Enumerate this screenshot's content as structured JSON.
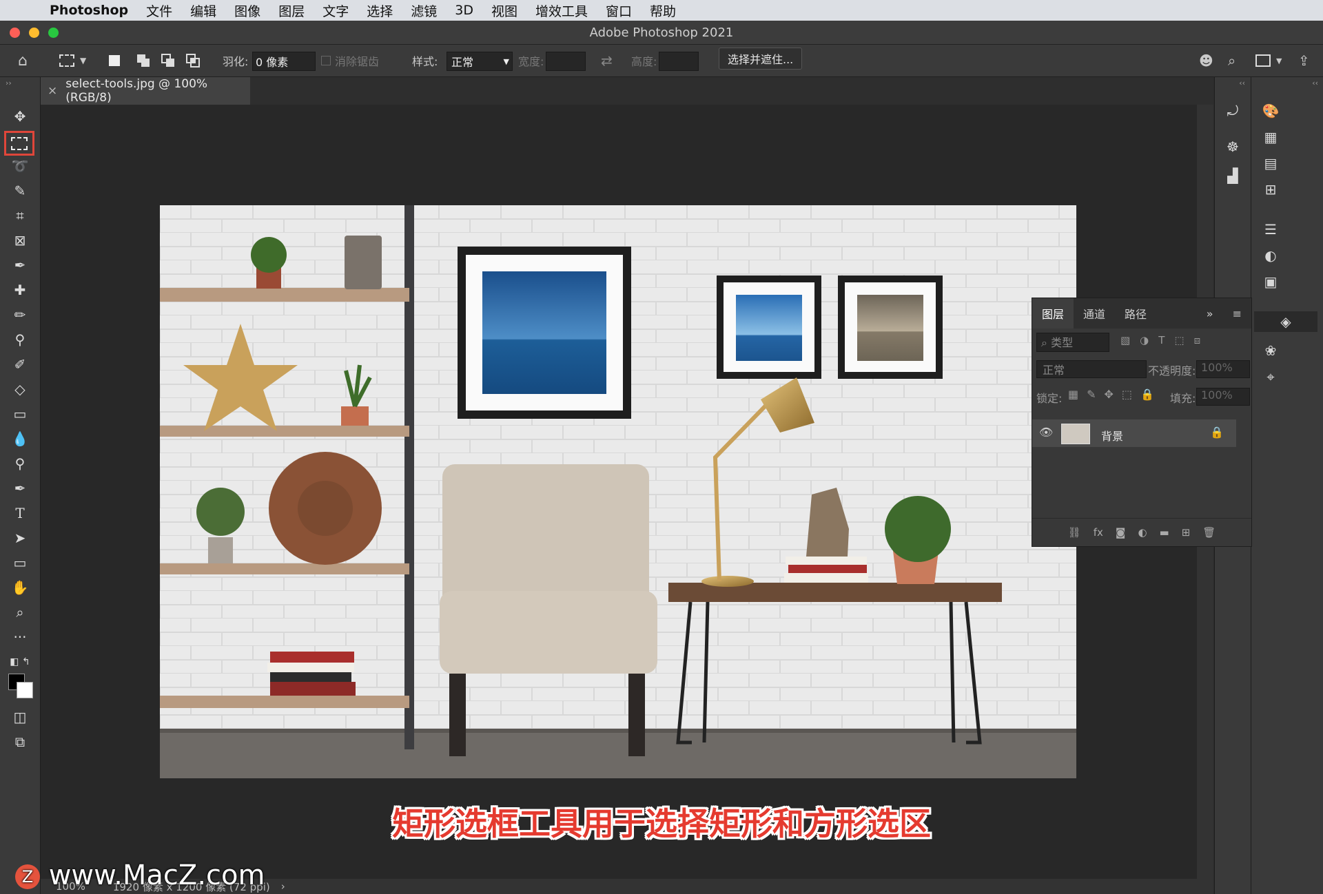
{
  "menubar": {
    "app": "Photoshop",
    "items": [
      "文件",
      "编辑",
      "图像",
      "图层",
      "文字",
      "选择",
      "滤镜",
      "3D",
      "视图",
      "增效工具",
      "窗口",
      "帮助"
    ]
  },
  "window": {
    "title": "Adobe Photoshop 2021"
  },
  "options": {
    "feather_label": "羽化:",
    "feather_value": "0 像素",
    "antialias_label": "消除锯齿",
    "style_label": "样式:",
    "style_value": "正常",
    "width_label": "宽度:",
    "height_label": "高度:",
    "select_mask_button": "选择并遮住..."
  },
  "document": {
    "tab_title": "select-tools.jpg @ 100%(RGB/8)"
  },
  "layers_panel": {
    "tabs": [
      "图层",
      "通道",
      "路径"
    ],
    "filter_label": "类型",
    "blend_mode": "正常",
    "opacity_label": "不透明度:",
    "opacity_value": "100%",
    "lock_label": "锁定:",
    "fill_label": "填充:",
    "fill_value": "100%",
    "layer_name": "背景"
  },
  "status": {
    "zoom": "100%",
    "doc_info": "1920 像素 x 1200 像素 (72 ppi)"
  },
  "caption": "矩形选框工具用于选择矩形和方形选区",
  "watermark": "www.MacZ.com",
  "colors": {
    "highlight": "#e0463a",
    "caption": "#e53a2f"
  }
}
